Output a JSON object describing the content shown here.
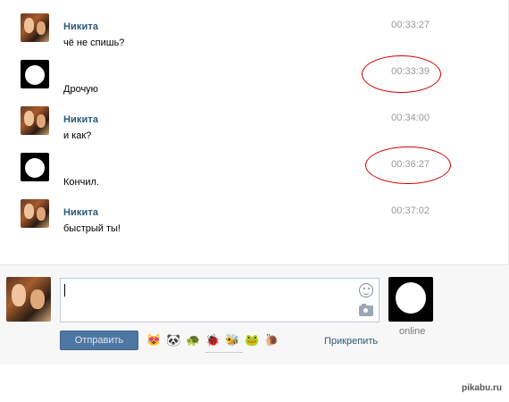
{
  "messages": [
    {
      "sender": "Никита",
      "text": "чё не спишь?",
      "time": "00:33:27"
    },
    {
      "sender": "",
      "text": "Дрочую",
      "time": "00:33:39"
    },
    {
      "sender": "Никита",
      "text": "и как?",
      "time": "00:34:00"
    },
    {
      "sender": "",
      "text": "Кончил.",
      "time": "00:36:27"
    },
    {
      "sender": "Никита",
      "text": "быстрый ты!",
      "time": "00:37:02"
    }
  ],
  "composer": {
    "send_label": "Отправить",
    "attach_label": "Прикрепить",
    "input_value": "",
    "partner_status": "online"
  },
  "emoji_bar": [
    "😻",
    "🐼",
    "🐢",
    "🐞",
    "🐝",
    "🐸",
    "🐌"
  ],
  "watermark": "pikabu.ru",
  "colors": {
    "link": "#2b587a",
    "send_button": "#4f77a3",
    "time": "#999999",
    "annotation_circle": "#d40000"
  }
}
